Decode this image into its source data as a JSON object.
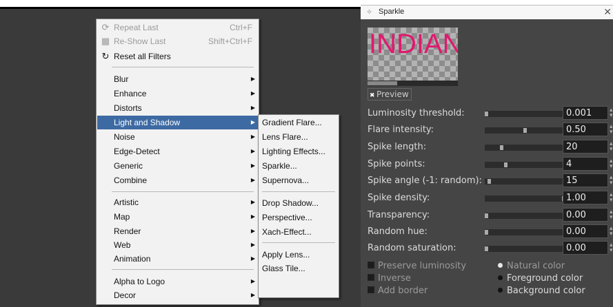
{
  "filters_menu": {
    "items": [
      {
        "label": "Repeat Last",
        "shortcut": "Ctrl+F",
        "icon": "repeat-icon",
        "disabled": true
      },
      {
        "label": "Re-Show Last",
        "shortcut": "Shift+Ctrl+F",
        "icon": "reshow-icon",
        "disabled": true
      },
      {
        "label": "Reset all Filters",
        "shortcut": "",
        "icon": "reset-icon",
        "disabled": false
      },
      {
        "label": "Blur"
      },
      {
        "label": "Enhance"
      },
      {
        "label": "Distorts"
      },
      {
        "label": "Light and Shadow"
      },
      {
        "label": "Noise"
      },
      {
        "label": "Edge-Detect"
      },
      {
        "label": "Generic"
      },
      {
        "label": "Combine"
      },
      {
        "label": "Artistic"
      },
      {
        "label": "Map"
      },
      {
        "label": "Render"
      },
      {
        "label": "Web"
      },
      {
        "label": "Animation"
      },
      {
        "label": "Alpha to Logo"
      },
      {
        "label": "Decor"
      }
    ]
  },
  "light_shadow_submenu": {
    "items": [
      {
        "label": "Gradient Flare..."
      },
      {
        "label": "Lens Flare..."
      },
      {
        "label": "Lighting Effects..."
      },
      {
        "label": "Sparkle..."
      },
      {
        "label": "Supernova..."
      },
      {
        "label": "Drop Shadow..."
      },
      {
        "label": "Perspective..."
      },
      {
        "label": "Xach-Effect..."
      },
      {
        "label": "Apply Lens..."
      },
      {
        "label": "Glass Tile..."
      }
    ]
  },
  "dialog": {
    "title": "Sparkle",
    "close_glyph": "✕",
    "preview_text": "INDIAN",
    "preview_progress": 0.33,
    "preview_label": "Preview",
    "preview_checked": true,
    "params": [
      {
        "label": "Luminosity threshold:",
        "value": "0.001",
        "fraction": 0.0
      },
      {
        "label": "Flare intensity:",
        "value": "0.50",
        "fraction": 0.5
      },
      {
        "label": "Spike length:",
        "value": "20",
        "fraction": 0.2
      },
      {
        "label": "Spike points:",
        "value": "4",
        "fraction": 0.25
      },
      {
        "label": "Spike angle (-1: random):",
        "value": "15",
        "fraction": 0.04
      },
      {
        "label": "Spike density:",
        "value": "1.00",
        "fraction": 1.0
      },
      {
        "label": "Transparency:",
        "value": "0.00",
        "fraction": 0.0
      },
      {
        "label": "Random hue:",
        "value": "0.00",
        "fraction": 0.0
      },
      {
        "label": "Random saturation:",
        "value": "0.00",
        "fraction": 0.0
      }
    ],
    "checkboxes": [
      {
        "label": "Preserve luminosity",
        "checked": false
      },
      {
        "label": "Inverse",
        "checked": false
      },
      {
        "label": "Add border",
        "checked": false
      }
    ],
    "radios": [
      {
        "label": "Natural color",
        "selected": true
      },
      {
        "label": "Foreground color",
        "selected": false
      },
      {
        "label": "Background color",
        "selected": false
      }
    ]
  },
  "colors": {
    "accent": "#3d6aa3",
    "preview_text": "#e0196e",
    "dialog_bg": "#454545"
  }
}
